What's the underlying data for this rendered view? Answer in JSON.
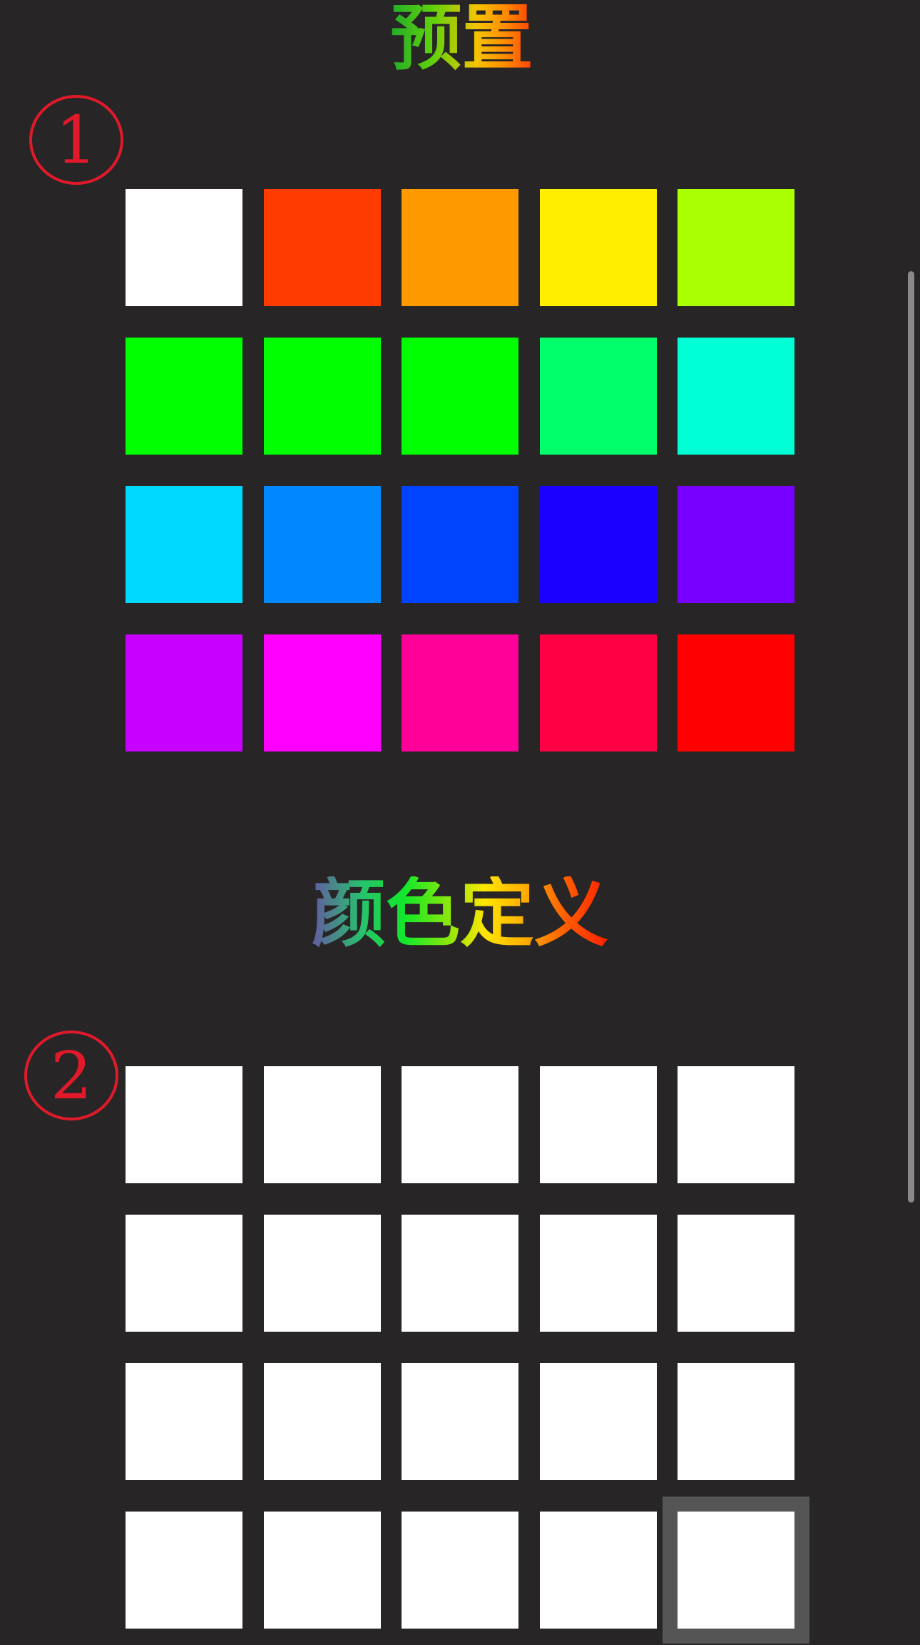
{
  "preset_section": {
    "title": "预置",
    "marker": "①",
    "swatches": [
      "#ffffff",
      "#ff3c00",
      "#ff9900",
      "#ffee00",
      "#aaff00",
      "#00ff00",
      "#00ff00",
      "#00ff00",
      "#00ff6a",
      "#00ffd4",
      "#00d9ff",
      "#0088ff",
      "#0044ff",
      "#1a00ff",
      "#7700ff",
      "#c800ff",
      "#ff00ff",
      "#ff0099",
      "#ff0044",
      "#ff0000"
    ]
  },
  "custom_section": {
    "title": "颜色定义",
    "marker": "②",
    "swatches": [
      "#ffffff",
      "#ffffff",
      "#ffffff",
      "#ffffff",
      "#ffffff",
      "#ffffff",
      "#ffffff",
      "#ffffff",
      "#ffffff",
      "#ffffff",
      "#ffffff",
      "#ffffff",
      "#ffffff",
      "#ffffff",
      "#ffffff",
      "#ffffff",
      "#ffffff",
      "#ffffff",
      "#ffffff",
      "#ffffff"
    ],
    "selected_index": 19
  },
  "colors": {
    "background": "#272526",
    "marker": "#e01a2a",
    "selection_border": "#565556",
    "scrollbar": "#8a8a8a"
  }
}
